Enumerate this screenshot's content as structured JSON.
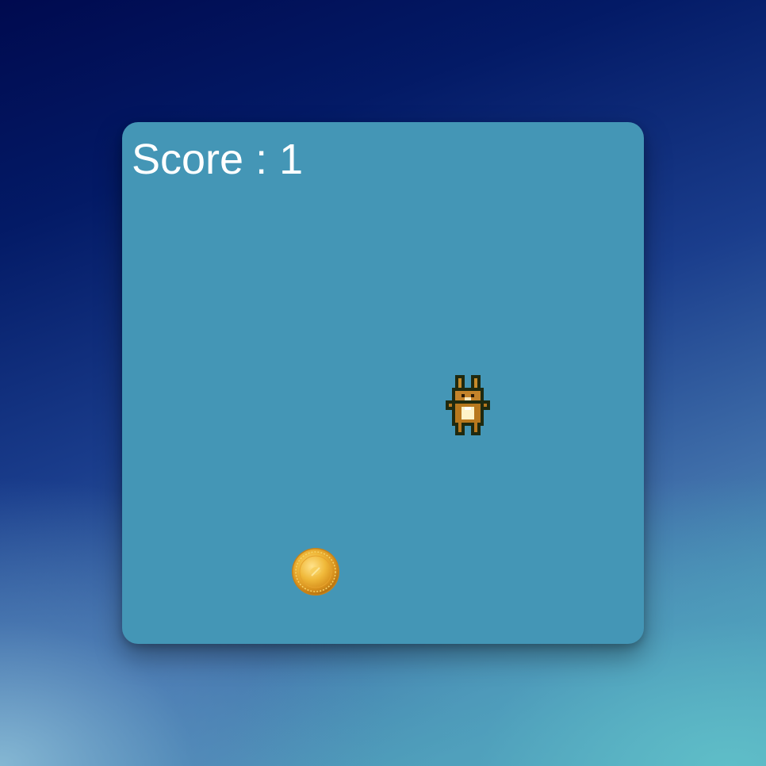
{
  "hud": {
    "score_label": "Score",
    "score_separator": ":",
    "score_value": "1"
  },
  "sprites": {
    "player": "bunny-icon",
    "collectible": "gold-coin-icon"
  },
  "colors": {
    "playfield": "#4496b6",
    "score_text": "#ffffff",
    "bunny_fur": "#b8781e",
    "bunny_belly": "#fff3c8",
    "coin_gold": "#e8a92a"
  }
}
